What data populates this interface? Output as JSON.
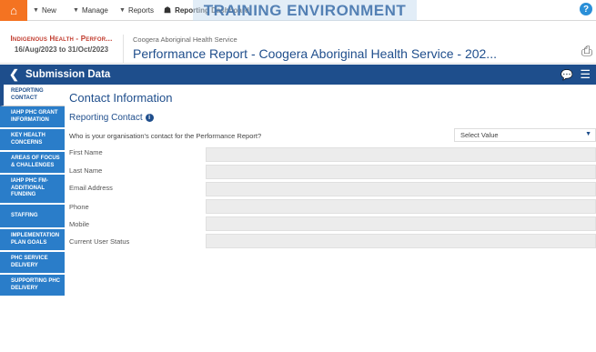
{
  "topbar": {
    "new_label": "New",
    "manage_label": "Manage",
    "reports_label": "Reports",
    "dashboard_label": "Reporting Dashboard",
    "training_banner": "TRAINING ENVIRONMENT"
  },
  "header": {
    "left_title": "Indigenous Health - Perfor...",
    "left_dates": "16/Aug/2023 to 31/Oct/2023",
    "org_name": "Coogera Aboriginal Health Service",
    "report_title": "Performance Report - Coogera Aboriginal Health Service - 202..."
  },
  "subbar": {
    "title": "Submission Data"
  },
  "sidebar": {
    "items": [
      {
        "label": "Reporting Contact",
        "active": true
      },
      {
        "label": "IAHP PHC Grant Information"
      },
      {
        "label": "Key Health Concerns"
      },
      {
        "label": "Areas of Focus & Challenges"
      },
      {
        "label": "IAHP PHC FM- Additional Funding"
      },
      {
        "label": "Staffing"
      },
      {
        "label": "Implementation Plan Goals"
      },
      {
        "label": "PHC Service Delivery"
      },
      {
        "label": "Supporting PHC Delivery"
      }
    ]
  },
  "main": {
    "section_title": "Contact Information",
    "subsection_title": "Reporting Contact",
    "question": "Who is your organisation's contact for the Performance Report?",
    "select_value": "Select Value",
    "fields": [
      {
        "label": "First Name"
      },
      {
        "label": "Last Name"
      },
      {
        "label": "Email Address"
      },
      {
        "label": "Phone"
      },
      {
        "label": "Mobile"
      },
      {
        "label": "Current User Status"
      }
    ]
  },
  "colors": {
    "brand_orange": "#f47321",
    "navy": "#1e4e8c",
    "sidebar_blue": "#2a7dc9",
    "header_red": "#c0392b"
  }
}
